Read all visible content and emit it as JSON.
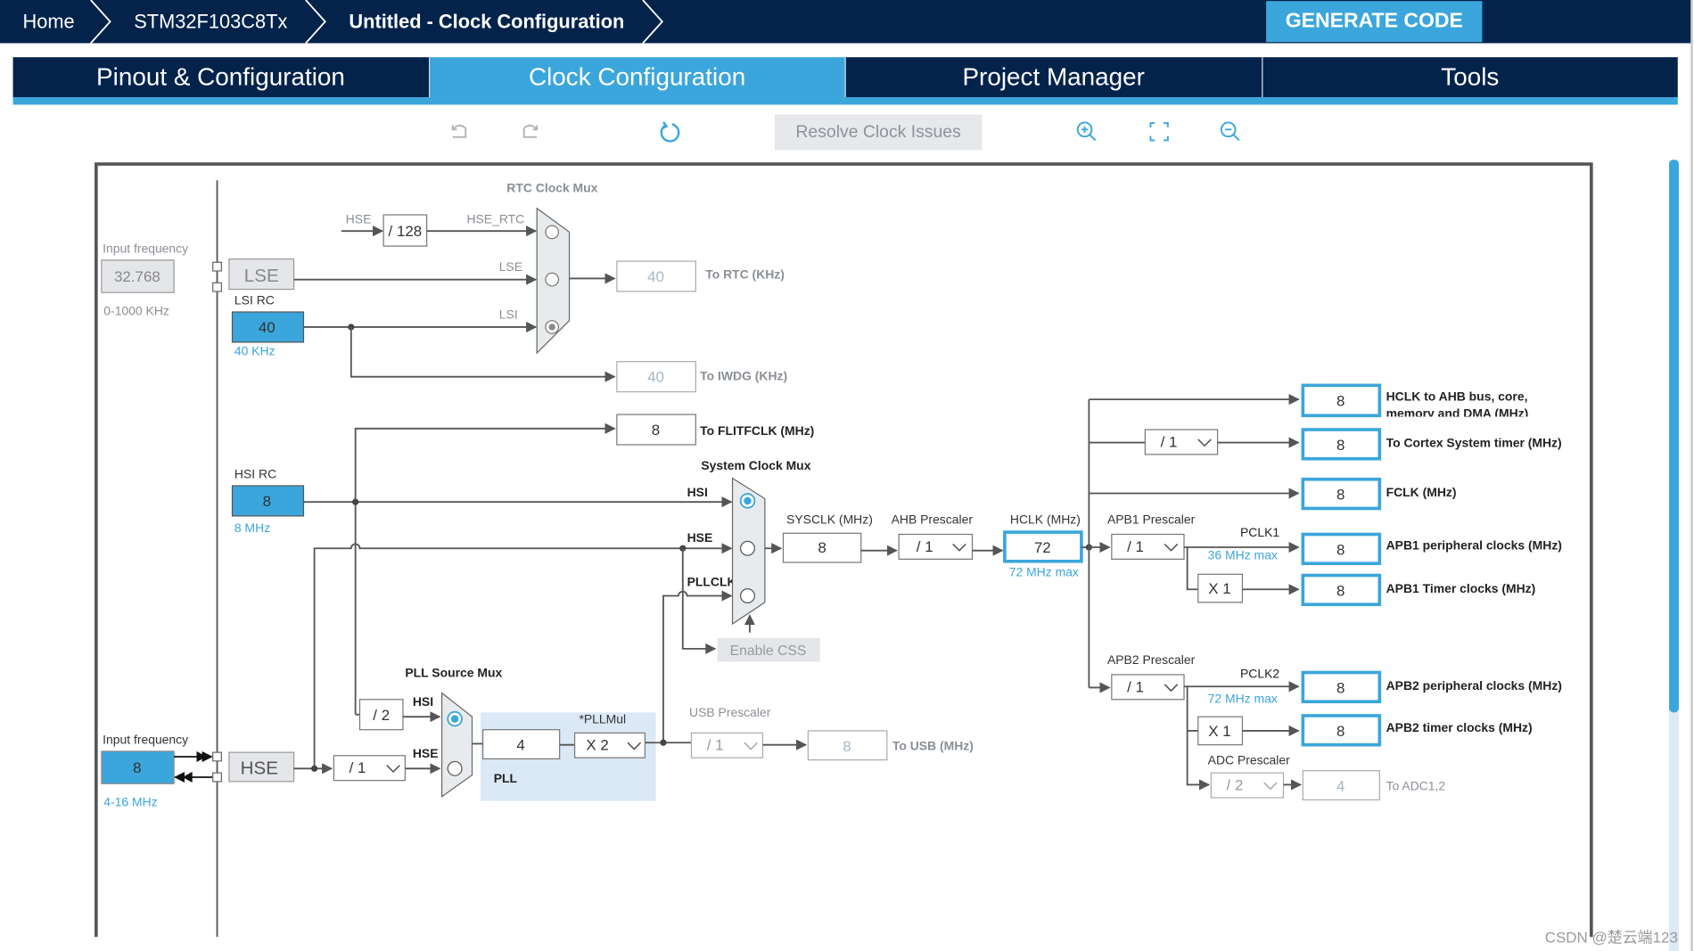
{
  "header": {
    "breadcrumb": [
      "Home",
      "STM32F103C8Tx",
      "Untitled - Clock Configuration"
    ],
    "generate_code": "GENERATE CODE"
  },
  "tabs": [
    {
      "label": "Pinout & Configuration",
      "active": false
    },
    {
      "label": "Clock Configuration",
      "active": true
    },
    {
      "label": "Project Manager",
      "active": false
    },
    {
      "label": "Tools",
      "active": false
    }
  ],
  "toolbar": {
    "icons": [
      "undo-icon",
      "redo-icon",
      "refresh-icon",
      "zoom-in-icon",
      "fit-icon",
      "zoom-out-icon"
    ],
    "resolve_label": "Resolve Clock Issues"
  },
  "colors": {
    "navy": "#03234b",
    "accent": "#3ba6db",
    "pll_region": "#dbe8f5"
  },
  "diagram": {
    "lse_input": {
      "label": "Input frequency",
      "value": "32.768",
      "range": "0-1000 KHz",
      "block": "LSE"
    },
    "lsi": {
      "label": "LSI RC",
      "value": "40",
      "note": "40 KHz"
    },
    "hsi": {
      "label": "HSI RC",
      "value": "8",
      "note": "8 MHz"
    },
    "hse_input": {
      "label": "Input frequency",
      "value": "8",
      "range": "4-16 MHz",
      "block": "HSE"
    },
    "rtc": {
      "mux_label": "RTC Clock Mux",
      "hse_label": "HSE",
      "div128": "/ 128",
      "hse_rtc": "HSE_RTC",
      "lse_label": "LSE",
      "lsi_label": "LSI",
      "selected": "LSI",
      "out_value": "40",
      "out_label": "To RTC (KHz)"
    },
    "iwdg": {
      "value": "40",
      "label": "To IWDG (KHz)"
    },
    "flitf": {
      "value": "8",
      "label": "To FLITFCLK (MHz)"
    },
    "sysmux": {
      "label": "System Clock Mux",
      "hsi": "HSI",
      "hse": "HSE",
      "pllclk": "PLLCLK",
      "selected": "HSI",
      "css": "Enable CSS"
    },
    "sysclk": {
      "label": "SYSCLK (MHz)",
      "value": "8"
    },
    "ahb": {
      "label": "AHB Prescaler",
      "value": "/ 1"
    },
    "hclk": {
      "label": "HCLK (MHz)",
      "value": "72",
      "max": "72 MHz max"
    },
    "pllsrc": {
      "label": "PLL Source Mux",
      "hsi": "HSI",
      "hse": "HSE",
      "div2": "/ 2",
      "hse_div": "/ 1",
      "selected": "HSI"
    },
    "pll": {
      "label": "PLL",
      "value": "4",
      "mul_label": "*PLLMul",
      "mul": "X 2"
    },
    "usb": {
      "label": "USB Prescaler",
      "value": "/ 1",
      "out": "8",
      "out_label": "To USB (MHz)"
    },
    "outputs": {
      "ahb_bus": {
        "value": "8",
        "label1": "HCLK to AHB bus, core,",
        "label2": "memory and DMA (MHz)"
      },
      "cortex": {
        "div": "/ 1",
        "value": "8",
        "label": "To Cortex System timer (MHz)"
      },
      "fclk": {
        "value": "8",
        "label": "FCLK (MHz)"
      },
      "apb1": {
        "label": "APB1 Prescaler",
        "div": "/ 1",
        "pclk": "PCLK1",
        "max": "36 MHz max",
        "value": "8",
        "out_label": "APB1 peripheral clocks (MHz)",
        "timer_mul": "X 1",
        "timer_value": "8",
        "timer_label": "APB1 Timer clocks (MHz)"
      },
      "apb2": {
        "label": "APB2 Prescaler",
        "div": "/ 1",
        "pclk": "PCLK2",
        "max": "72 MHz max",
        "value": "8",
        "out_label": "APB2 peripheral clocks (MHz)",
        "timer_mul": "X 1",
        "timer_value": "8",
        "timer_label": "APB2 timer clocks (MHz)"
      },
      "adc": {
        "label": "ADC Prescaler",
        "div": "/ 2",
        "value": "4",
        "out_label": "To ADC1,2"
      }
    }
  },
  "watermark": "CSDN @楚云端123"
}
